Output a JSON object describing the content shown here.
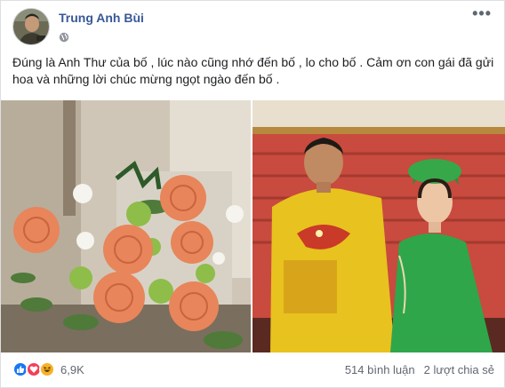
{
  "post": {
    "author": "Trung Anh Bùi",
    "privacy_icon": "globe-icon",
    "more_label": "•••",
    "text": "Đúng là Anh Thư của bố , lúc nào cũng nhớ đến bố , lo cho bố . Cảm ơn con gái đã gửi hoa và những lời chúc mừng ngọt ngào đến bố ."
  },
  "photos": [
    {
      "subject": "flower-bouquet-photo"
    },
    {
      "subject": "couple-traditional-dress-photo"
    }
  ],
  "footer": {
    "reaction_icons": [
      "like-icon",
      "love-icon",
      "haha-icon"
    ],
    "reaction_count": "6,9K",
    "comments": "514 bình luận",
    "shares": "2 lượt chia sẻ"
  },
  "colors": {
    "author_link": "#385898",
    "like": "#1877f2",
    "love": "#f33e58",
    "haha": "#f7b125"
  }
}
